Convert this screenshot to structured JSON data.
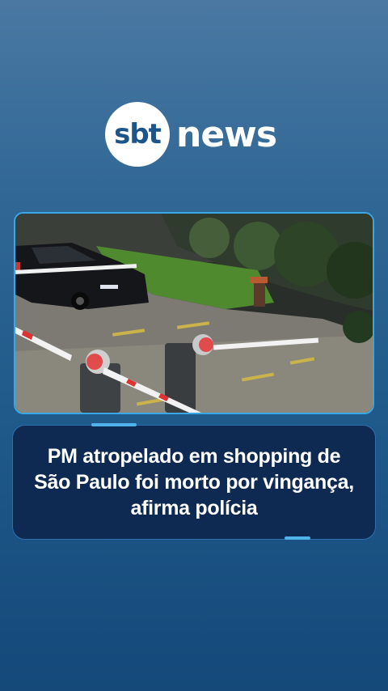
{
  "brand": {
    "logo_circle_text": "sbt",
    "logo_word": "news",
    "colors": {
      "accent": "#4fb3ea",
      "card_bg": "#0f2a52",
      "logo_blue": "#1d5588"
    }
  },
  "media": {
    "icon": "security-camera-photo",
    "description_visible": ""
  },
  "headline": {
    "text": "PM atropelado em shopping de São Paulo foi morto por vingança, afirma polícia"
  }
}
